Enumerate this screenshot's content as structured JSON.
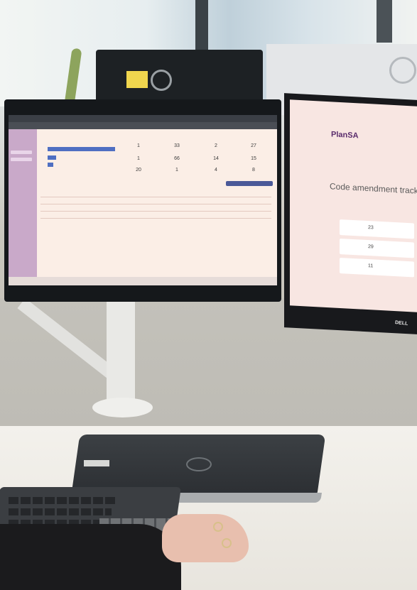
{
  "scene": {
    "description_labels": [],
    "colors": {
      "screen_bg": "#fbeee6",
      "accent_bar": "#4f6fc2",
      "sidebar": "#c9a9c9",
      "desk": "#efece6"
    }
  },
  "left_screen": {
    "kpi_values": [
      "1",
      "33",
      "2",
      "27",
      "1",
      "66",
      "14",
      "15",
      "20",
      "1",
      "4",
      "8"
    ]
  },
  "right_screen": {
    "logo": "PlanSA",
    "title": "Code amendment tracking",
    "card_values": [
      "23",
      "29",
      "11"
    ]
  },
  "brands": {
    "monitor_right": "DELL"
  }
}
